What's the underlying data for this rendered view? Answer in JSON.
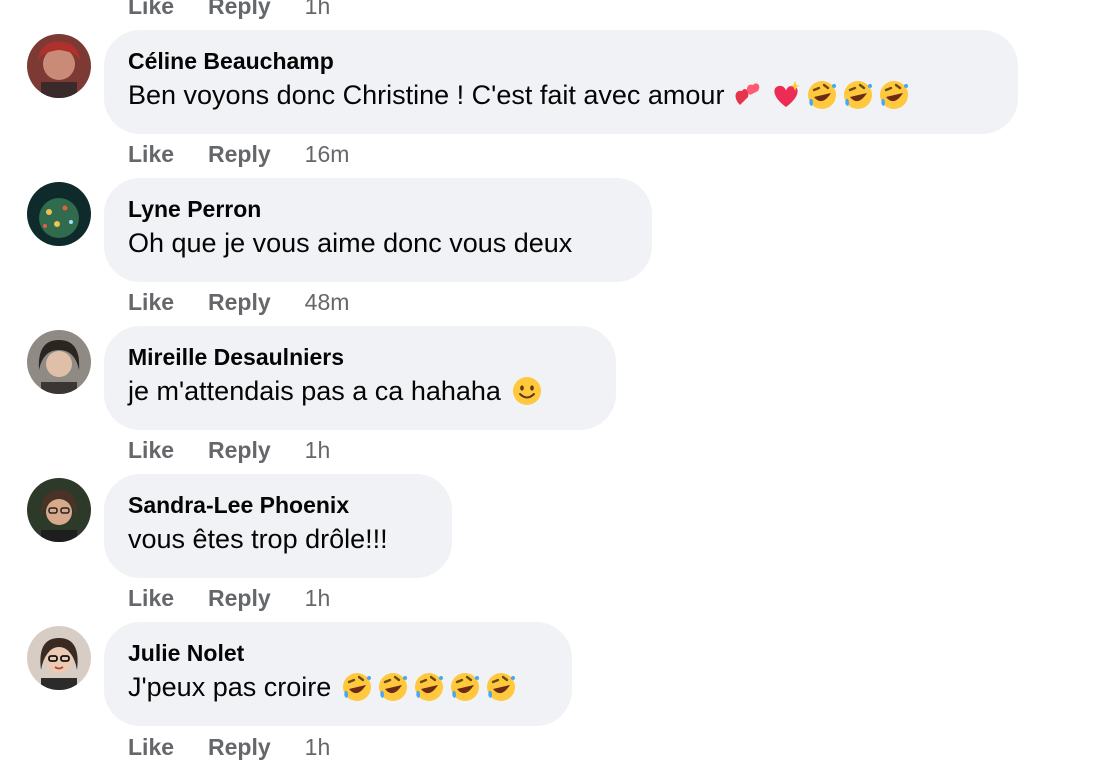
{
  "top_actions": {
    "like": "Like",
    "reply": "Reply",
    "time": "1h"
  },
  "comments": [
    {
      "author": "Céline Beauchamp",
      "text": "Ben voyons donc Christine ! C'est fait avec amour",
      "emojis": [
        "two-hearts",
        "sparkling-heart",
        "rofl",
        "rofl",
        "rofl"
      ],
      "like": "Like",
      "reply": "Reply",
      "time": "16m",
      "avatar_color": "#8a3b36"
    },
    {
      "author": "Lyne Perron",
      "text": "Oh que je vous aime donc vous deux",
      "emojis": [],
      "like": "Like",
      "reply": "Reply",
      "time": "48m",
      "avatar_color": "#1f4a3a"
    },
    {
      "author": "Mireille Desaulniers",
      "text": "je m'attendais pas a ca hahaha",
      "emojis": [
        "smile"
      ],
      "like": "Like",
      "reply": "Reply",
      "time": "1h",
      "avatar_color": "#6b6560"
    },
    {
      "author": "Sandra-Lee Phoenix",
      "text": "vous êtes trop drôle!!!",
      "emojis": [],
      "like": "Like",
      "reply": "Reply",
      "time": "1h",
      "avatar_color": "#3d4a33"
    },
    {
      "author": "Julie Nolet",
      "text": "J'peux pas croire",
      "emojis": [
        "rofl",
        "rofl",
        "rofl",
        "rofl",
        "rofl"
      ],
      "like": "Like",
      "reply": "Reply",
      "time": "1h",
      "avatar_color": "#c9bdb5"
    }
  ],
  "colors": {
    "bubble": "#f0f2f5",
    "meta_text": "#65676b",
    "text": "#050505"
  }
}
